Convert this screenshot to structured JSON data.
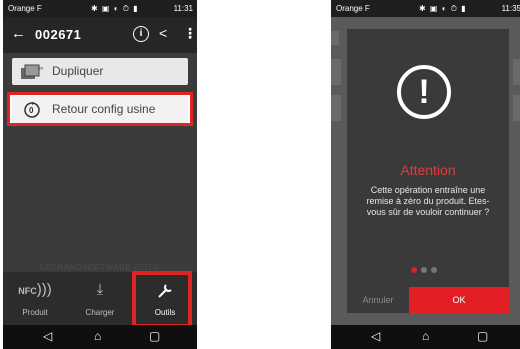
{
  "left": {
    "status": {
      "carrier": "Orange F",
      "time": "11:31"
    },
    "app_bar": {
      "title": "002671"
    },
    "menu": {
      "dupliquer": "Dupliquer",
      "retour_config": "Retour config usine"
    },
    "watermark": "LEGRANDSOFTWARE 2016©",
    "tabs": {
      "produit": "Produit",
      "charger": "Charger",
      "outils": "Outils"
    },
    "nfc_icon_text": "NFC"
  },
  "right": {
    "status": {
      "carrier": "Orange F",
      "time": "11:35"
    },
    "dialog": {
      "title": "Attention",
      "message": "Cette opération entraîne une remise à zéro du produit. Etes-vous sûr de vouloir continuer ?",
      "cancel": "Annuler",
      "ok": "OK"
    }
  },
  "colors": {
    "accent_red": "#e31e24",
    "highlight_red": "#e02424",
    "app_bar": "#262626"
  },
  "icons": [
    "back-arrow-icon",
    "info-icon",
    "share-icon",
    "more-vertical-icon",
    "duplicate-icon",
    "factory-reset-icon",
    "nfc-icon",
    "download-icon",
    "wrench-icon",
    "warning-icon",
    "nav-back-icon",
    "nav-home-icon",
    "nav-recent-icon"
  ]
}
